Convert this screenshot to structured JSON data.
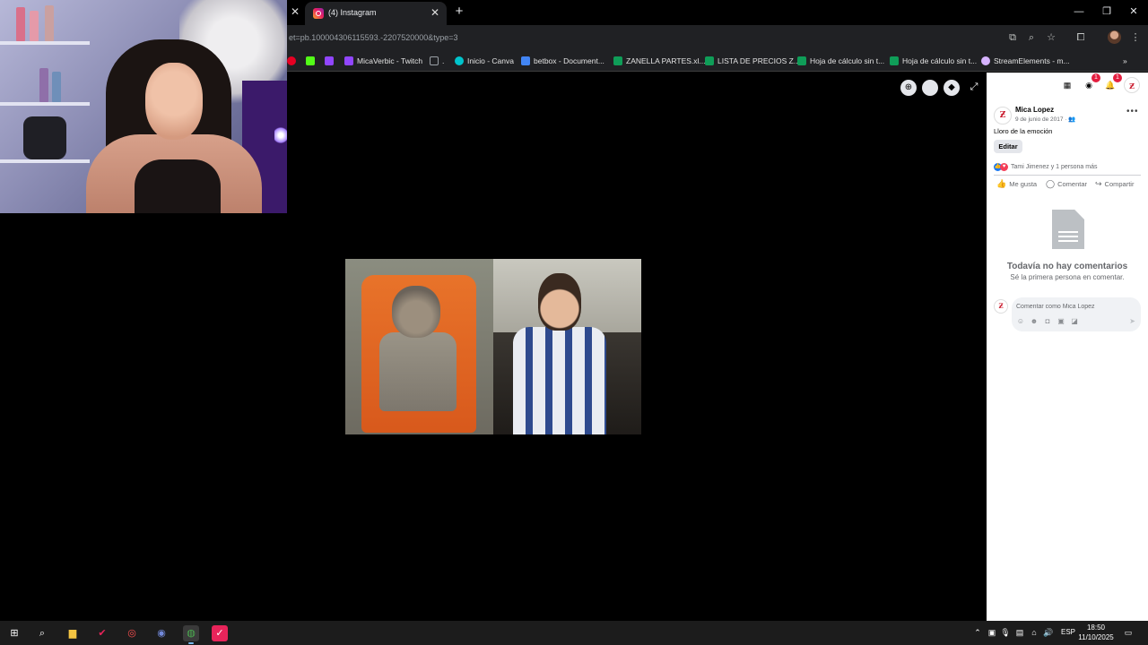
{
  "browser": {
    "tab_title": "(4) Instagram",
    "new_tab_symbol": "+",
    "url": "et=pb.100004306115593.-2207520000&type=3",
    "window_controls": [
      "minimize-icon",
      "restore-icon",
      "close-icon"
    ],
    "bookmarks": [
      {
        "label": "",
        "icon": "pinterest-icon",
        "color": "#e60023"
      },
      {
        "label": "",
        "icon": "kick-icon",
        "color": "#53fc18"
      },
      {
        "label": "",
        "icon": "twitch-icon",
        "color": "#9146ff"
      },
      {
        "label": "MicaVerbic - Twitch",
        "icon": "twitch-icon",
        "color": "#9146ff"
      },
      {
        "label": ".",
        "icon": "folder-icon",
        "color": "#9aa0a6"
      },
      {
        "label": "Inicio - Canva",
        "icon": "canva-icon",
        "color": "#00c4cc"
      },
      {
        "label": "betbox - Document...",
        "icon": "docs-icon",
        "color": "#4285f4"
      },
      {
        "label": "ZANELLA PARTES.xl...",
        "icon": "sheets-icon",
        "color": "#0f9d58"
      },
      {
        "label": "LISTA DE PRECIOS Z...",
        "icon": "sheets-icon",
        "color": "#0f9d58"
      },
      {
        "label": "Hoja de cálculo sin t...",
        "icon": "sheets-icon",
        "color": "#0f9d58"
      },
      {
        "label": "Hoja de cálculo sin t...",
        "icon": "sheets-icon",
        "color": "#0f9d58"
      },
      {
        "label": "StreamElements - m...",
        "icon": "streamelements-icon",
        "color": "#d6b3ff"
      }
    ],
    "more_bookmarks": "»"
  },
  "panel": {
    "badges": {
      "messenger": "1",
      "notifications": "1"
    },
    "post": {
      "author": "Mica Lopez",
      "date": "9 de junio de 2017 ·",
      "text": "Lloro de la emoción",
      "edit_label": "Editar",
      "reactions_text": "Tami Jimenez y 1 persona más",
      "like_label": "Me gusta",
      "comment_label": "Comentar",
      "share_label": "Compartir"
    },
    "empty": {
      "title": "Todavía no hay comentarios",
      "subtitle": "Sé la primera persona en comentar."
    },
    "comment_placeholder": "Comentar como Mica Lopez"
  },
  "taskbar": {
    "language": "ESP",
    "time": "18:50",
    "date": "11/10/2025"
  },
  "colors": {
    "facebook_blue": "#1877f2",
    "badge_red": "#e41e3f",
    "chrome_dark": "#202124"
  }
}
